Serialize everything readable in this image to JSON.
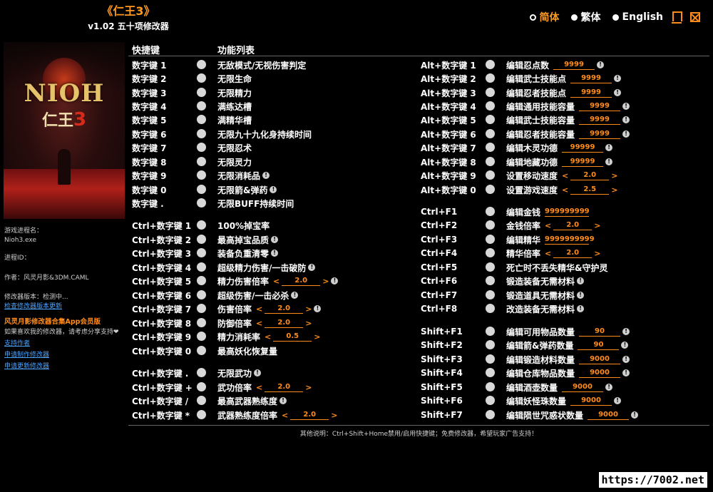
{
  "app": {
    "title": "《仁王3》",
    "version": "v1.02 五十项修改器"
  },
  "languages": [
    {
      "label": "简体",
      "selected": true
    },
    {
      "label": "繁体",
      "selected": false
    },
    {
      "label": "English",
      "selected": false
    }
  ],
  "cover": {
    "logo": "NIOH",
    "subtitle": "仁王",
    "num": "3"
  },
  "info": {
    "process_label": "游戏进程名：",
    "process_value": "Nioh3.exe",
    "pid_label": "进程ID：",
    "author": "作者：风灵月影&3DM.CAML",
    "version_label": "修改器版本：检测中...",
    "check_update": "检查修改器版本更新",
    "vip": "风灵月影修改器合集App会员版",
    "support_text": "如果喜欢我的修改器，请考虑分享支持❤",
    "support_author": "支持作者",
    "request_make": "申请制作修改器",
    "request_update": "申请更新修改器"
  },
  "header": {
    "hotkey": "快捷键",
    "features": "功能列表"
  },
  "left_rows": [
    {
      "key": "数字键 1",
      "label": "无敌模式/无视伤害判定",
      "info": false,
      "value": null
    },
    {
      "key": "数字键 2",
      "label": "无限生命",
      "info": false,
      "value": null
    },
    {
      "key": "数字键 3",
      "label": "无限精力",
      "info": false,
      "value": null
    },
    {
      "key": "数字键 4",
      "label": "满练达槽",
      "info": false,
      "value": null
    },
    {
      "key": "数字键 5",
      "label": "满精华槽",
      "info": false,
      "value": null
    },
    {
      "key": "数字键 6",
      "label": "无限九十九化身持续时间",
      "info": false,
      "value": null
    },
    {
      "key": "数字键 7",
      "label": "无限忍术",
      "info": false,
      "value": null
    },
    {
      "key": "数字键 8",
      "label": "无限灵力",
      "info": false,
      "value": null
    },
    {
      "key": "数字键 9",
      "label": "无限消耗品",
      "info": true,
      "value": null
    },
    {
      "key": "数字键 0",
      "label": "无限箭&弹药",
      "info": true,
      "value": null
    },
    {
      "key": "数字键 .",
      "label": "无限BUFF持续时间",
      "info": false,
      "value": null
    },
    {
      "key": "Ctrl+数字键 1",
      "label": "100%掉宝率",
      "info": false,
      "value": null
    },
    {
      "key": "Ctrl+数字键 2",
      "label": "最高掉宝品质",
      "info": true,
      "value": null
    },
    {
      "key": "Ctrl+数字键 3",
      "label": "装备负重清零",
      "info": true,
      "value": null
    },
    {
      "key": "Ctrl+数字键 4",
      "label": "超级精力伤害/一击破防",
      "info": true,
      "value": null
    },
    {
      "key": "Ctrl+数字键 5",
      "label": "精力伤害倍率",
      "info": true,
      "value": "2.0"
    },
    {
      "key": "Ctrl+数字键 6",
      "label": "超级伤害/一击必杀",
      "info": true,
      "value": null
    },
    {
      "key": "Ctrl+数字键 7",
      "label": "伤害倍率",
      "info": true,
      "value": "2.0"
    },
    {
      "key": "Ctrl+数字键 8",
      "label": "防御倍率",
      "info": false,
      "value": "2.0"
    },
    {
      "key": "Ctrl+数字键 9",
      "label": "精力消耗率",
      "info": false,
      "value": "0.5"
    },
    {
      "key": "Ctrl+数字键 0",
      "label": "最高妖化恢复量",
      "info": false,
      "value": null
    },
    {
      "key": "Ctrl+数字键 .",
      "label": "无限武功",
      "info": true,
      "value": null
    },
    {
      "key": "Ctrl+数字键 +",
      "label": "武功倍率",
      "info": false,
      "value": "2.0"
    },
    {
      "key": "Ctrl+数字键 /",
      "label": "最高武器熟练度",
      "info": true,
      "value": null
    },
    {
      "key": "Ctrl+数字键 *",
      "label": "武器熟练度倍率",
      "info": false,
      "value": "2.0"
    }
  ],
  "right_rows": [
    {
      "key": "Alt+数字键 1",
      "label": "编辑忍点数",
      "value": "9999",
      "stepper": false,
      "info": true
    },
    {
      "key": "Alt+数字键 2",
      "label": "编辑武士技能点",
      "value": "9999",
      "stepper": false,
      "info": true
    },
    {
      "key": "Alt+数字键 3",
      "label": "编辑忍者技能点",
      "value": "9999",
      "stepper": false,
      "info": true
    },
    {
      "key": "Alt+数字键 4",
      "label": "编辑通用技能容量",
      "value": "9999",
      "stepper": false,
      "info": true
    },
    {
      "key": "Alt+数字键 5",
      "label": "编辑武士技能容量",
      "value": "9999",
      "stepper": false,
      "info": true
    },
    {
      "key": "Alt+数字键 6",
      "label": "编辑忍者技能容量",
      "value": "9999",
      "stepper": false,
      "info": true
    },
    {
      "key": "Alt+数字键 7",
      "label": "编辑木灵功德",
      "value": "99999",
      "stepper": false,
      "info": true
    },
    {
      "key": "Alt+数字键 8",
      "label": "编辑地藏功德",
      "value": "99999",
      "stepper": false,
      "info": true
    },
    {
      "key": "Alt+数字键 9",
      "label": "设置移动速度",
      "value": "2.0",
      "stepper": true,
      "info": false
    },
    {
      "key": "Alt+数字键 0",
      "label": "设置游戏速度",
      "value": "2.5",
      "stepper": true,
      "info": false
    },
    {
      "key": "Ctrl+F1",
      "label": "编辑金钱",
      "value": "999999999",
      "stepper": false,
      "info": false
    },
    {
      "key": "Ctrl+F2",
      "label": "金钱倍率",
      "value": "2.0",
      "stepper": true,
      "info": false
    },
    {
      "key": "Ctrl+F3",
      "label": "编辑精华",
      "value": "9999999999",
      "stepper": false,
      "info": false
    },
    {
      "key": "Ctrl+F4",
      "label": "精华倍率",
      "value": "2.0",
      "stepper": true,
      "info": false
    },
    {
      "key": "Ctrl+F5",
      "label": "死亡时不丢失精华&守护灵",
      "value": null,
      "stepper": false,
      "info": false
    },
    {
      "key": "Ctrl+F6",
      "label": "锻造装备无需材料",
      "value": null,
      "stepper": false,
      "info": true
    },
    {
      "key": "Ctrl+F7",
      "label": "锻造道具无需材料",
      "value": null,
      "stepper": false,
      "info": true
    },
    {
      "key": "Ctrl+F8",
      "label": "改造装备无需材料",
      "value": null,
      "stepper": false,
      "info": true
    },
    {
      "key": "Shift+F1",
      "label": "编辑可用物品数量",
      "value": "90",
      "stepper": false,
      "info": true
    },
    {
      "key": "Shift+F2",
      "label": "编辑箭&弹药数量",
      "value": "90",
      "stepper": false,
      "info": true
    },
    {
      "key": "Shift+F3",
      "label": "编辑锻造材料数量",
      "value": "9000",
      "stepper": false,
      "info": true
    },
    {
      "key": "Shift+F4",
      "label": "编辑仓库物品数量",
      "value": "9000",
      "stepper": false,
      "info": true
    },
    {
      "key": "Shift+F5",
      "label": "编辑酒壶数量",
      "value": "9000",
      "stepper": false,
      "info": true
    },
    {
      "key": "Shift+F6",
      "label": "编辑妖怪珠数量",
      "value": "9000",
      "stepper": false,
      "info": true
    },
    {
      "key": "Shift+F7",
      "label": "编辑陨世咒惑状数量",
      "value": "9000",
      "stepper": false,
      "info": true
    }
  ],
  "footer": "其他说明：Ctrl+Shift+Home禁用/启用快捷键；免费修改器，希望玩家广告支持！",
  "watermark": "https://7002.net"
}
